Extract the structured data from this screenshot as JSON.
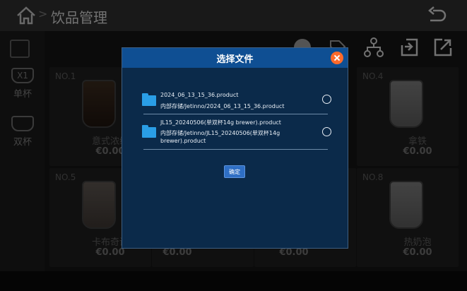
{
  "header": {
    "title": "饮品管理",
    "separator": ">"
  },
  "rail": {
    "single_label": "单杯",
    "double_label": "双杯",
    "single_badge": "X1"
  },
  "tiles": [
    {
      "no": "NO.1",
      "name": "意式浓缩",
      "price": "€0.00",
      "cup": "dark"
    },
    {
      "no": "NO.4",
      "name": "拿铁",
      "price": "€0.00",
      "cup": "cream"
    },
    {
      "no": "NO.5",
      "name": "卡布奇诺",
      "price": "€0.00",
      "cup": "light"
    },
    {
      "no": "NO.8",
      "name": "热奶泡",
      "price": "€0.00",
      "cup": "cream"
    }
  ],
  "hidden_prices": [
    "€0.00",
    "€0.00"
  ],
  "dialog": {
    "title": "选择文件",
    "files": [
      {
        "name": "2024_06_13_15_36.product",
        "path": "内部存储/Jetinno/2024_06_13_15_36.product"
      },
      {
        "name": "JL15_20240506(单双杯14g brewer).product",
        "path": "内部存储/Jetinno/JL15_20240506(单双杯14g brewer).product"
      }
    ],
    "confirm_label": "确定"
  },
  "colors": {
    "dialog_header": "#0f4f93",
    "dialog_body": "#0b2a4a",
    "close_button": "#ff6a2a",
    "folder_icon": "#2a9ee6"
  }
}
